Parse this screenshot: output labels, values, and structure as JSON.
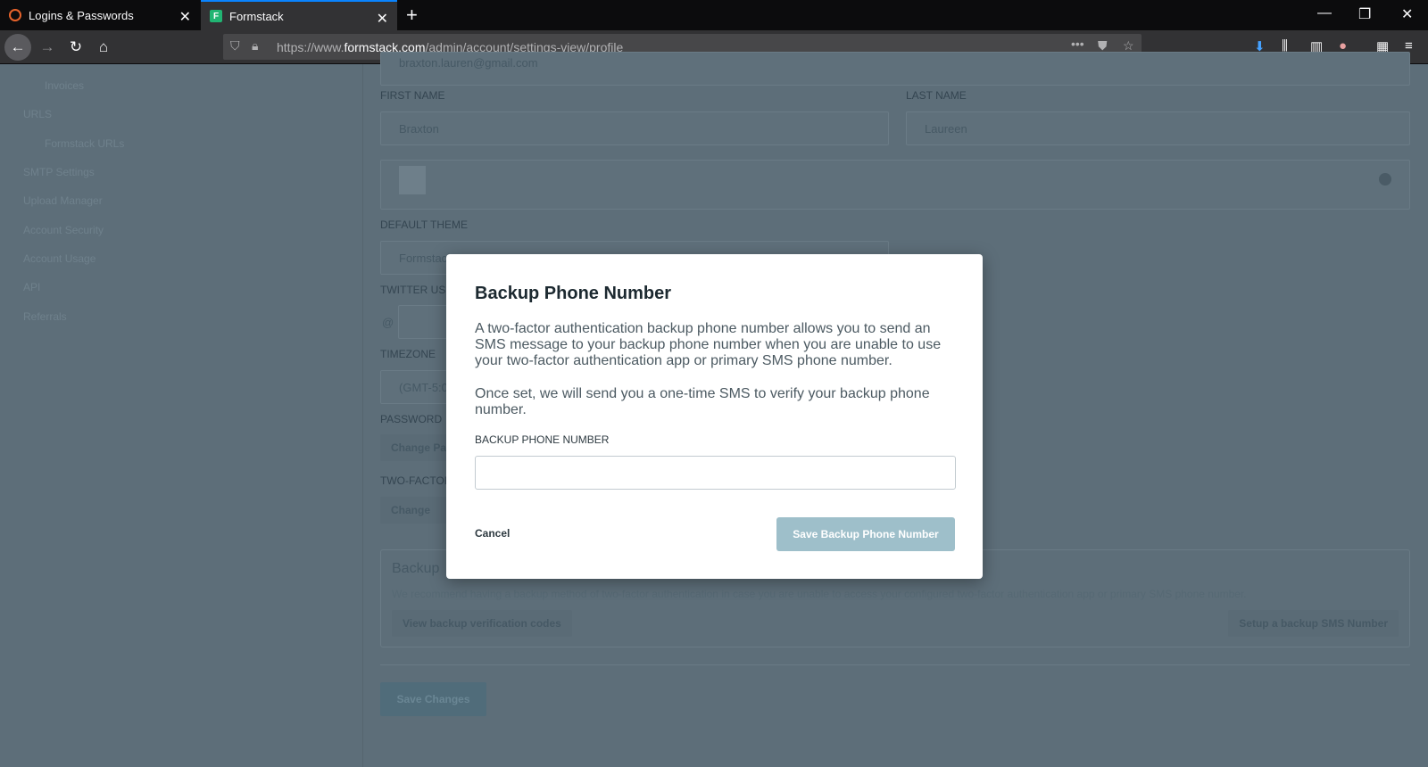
{
  "browser": {
    "tabs": [
      {
        "title": "Logins & Passwords",
        "active": false
      },
      {
        "title": "Formstack",
        "active": true
      }
    ],
    "url_prefix": "https://www.",
    "url_domain": "formstack.com",
    "url_path": "/admin/account/settings-view/profile"
  },
  "sidebar": {
    "items": [
      "Invoices",
      "URLS",
      "Formstack URLs",
      "SMTP Settings",
      "Upload Manager",
      "Account Security",
      "Account Usage",
      "API",
      "Referrals"
    ]
  },
  "profile": {
    "email_value": "braxton.lauren@gmail.com",
    "first_name_label": "FIRST NAME",
    "first_name_value": "Braxton",
    "last_name_label": "LAST NAME",
    "last_name_value": "Laureen",
    "theme_label": "DEFAULT THEME",
    "theme_value": "Formstack",
    "twitter_label": "TWITTER US",
    "twitter_prefix": "@",
    "timezone_label": "TIMEZONE",
    "timezone_value": "(GMT-5:0",
    "password_label": "PASSWORD",
    "password_button": "Change Pa",
    "twofactor_label": "TWO-FACTOR",
    "twofactor_button": "Change",
    "backup_title": "Backup",
    "backup_desc": "We recommend having a backup method of two-factor authentication in case you are unable to access your configured two-factor authentication app or primary SMS phone number.",
    "view_codes_button": "View backup verification codes",
    "setup_sms_button": "Setup a backup SMS Number",
    "save_changes_button": "Save Changes"
  },
  "modal": {
    "title": "Backup Phone Number",
    "paragraph1": "A two-factor authentication backup phone number allows you to send an SMS message to your backup phone number when you are unable to use your two-factor authentication app or primary SMS phone number.",
    "paragraph2": "Once set, we will send you a one-time SMS to verify your backup phone number.",
    "field_label": "BACKUP PHONE NUMBER",
    "field_value": "",
    "cancel_label": "Cancel",
    "save_label": "Save Backup Phone Number",
    "save_color": "#9ebfca"
  }
}
